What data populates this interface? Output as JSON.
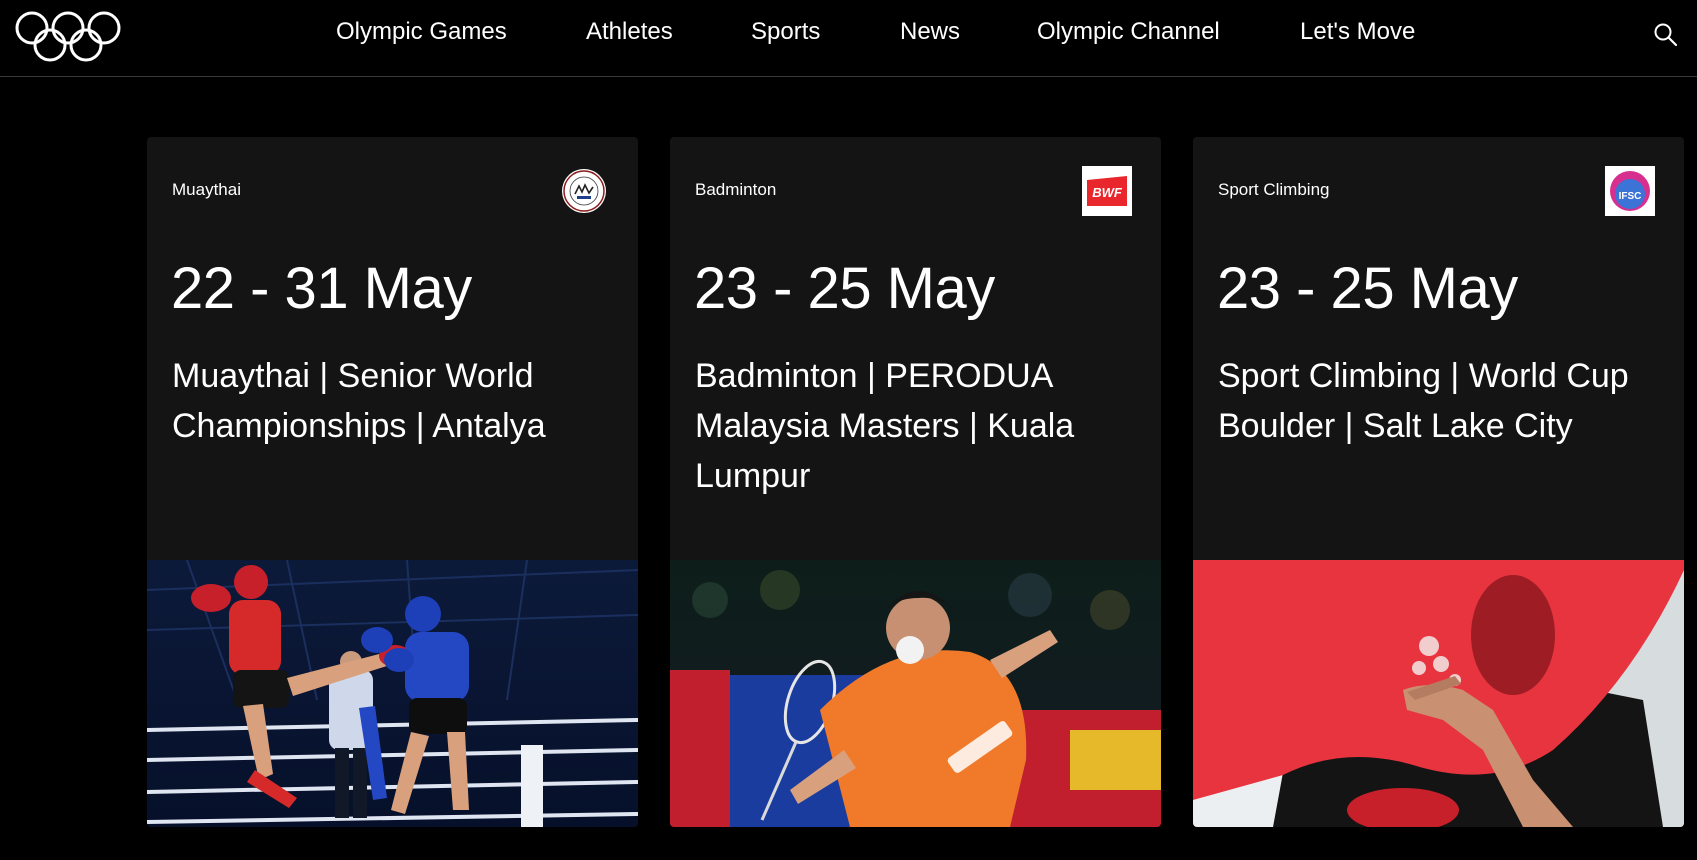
{
  "brand": {
    "logo_icon": "olympic-rings-icon"
  },
  "nav": {
    "items": [
      {
        "label": "Olympic Games"
      },
      {
        "label": "Athletes"
      },
      {
        "label": "Sports"
      },
      {
        "label": "News"
      },
      {
        "label": "Olympic Channel"
      },
      {
        "label": "Let's Move"
      }
    ],
    "search_icon": "search-icon"
  },
  "cards": [
    {
      "sport": "Muaythai",
      "date": "22 - 31 May",
      "title": "Muaythai | Senior World Championships | Antalya",
      "federation_logo": "ifma-logo",
      "image": "muaythai-fight-photo"
    },
    {
      "sport": "Badminton",
      "date": "23 - 25 May",
      "title": "Badminton | PERODUA Malaysia Masters | Kuala Lumpur",
      "federation_logo": "bwf-logo",
      "federation_logo_text": "BWF",
      "image": "badminton-player-photo"
    },
    {
      "sport": "Sport Climbing",
      "date": "23 - 25 May",
      "title": "Sport Climbing | World Cup Boulder | Salt Lake City",
      "federation_logo": "ifsc-logo",
      "federation_logo_text": "IFSC",
      "image": "climbing-hold-photo"
    }
  ],
  "colors": {
    "background": "#000000",
    "card": "#141414",
    "text": "#ffffff",
    "bwf_red": "#e8262b",
    "climbing_red": "#e8343f"
  }
}
